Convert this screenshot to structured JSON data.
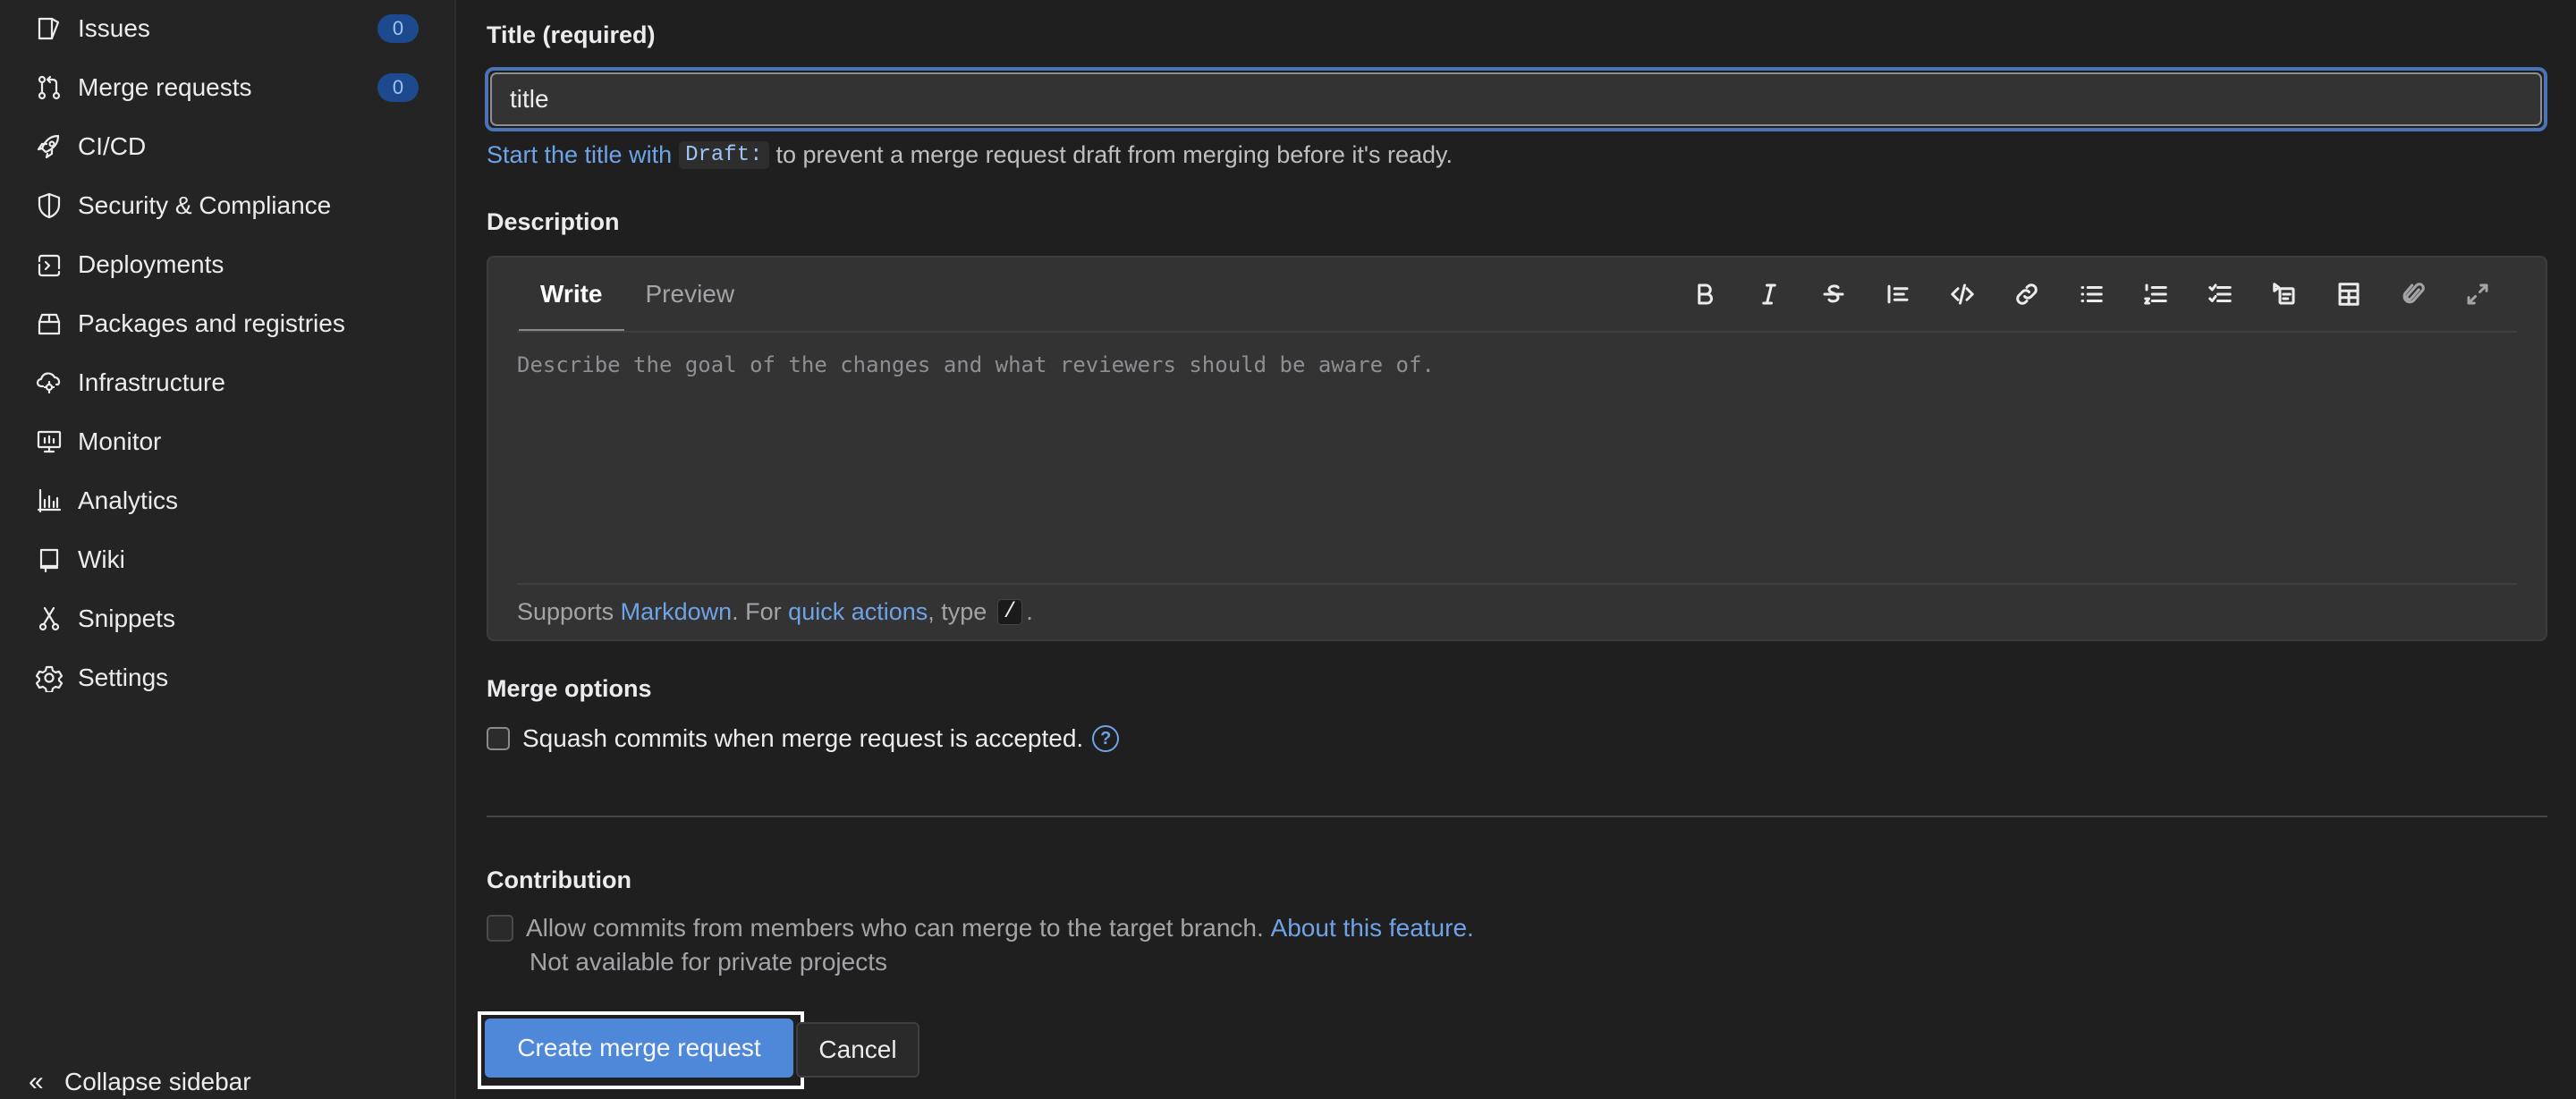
{
  "sidebar": {
    "items": [
      {
        "label": "Issues",
        "icon": "issues-icon",
        "badge": "0"
      },
      {
        "label": "Merge requests",
        "icon": "merge-request-icon",
        "badge": "0"
      },
      {
        "label": "CI/CD",
        "icon": "rocket-icon"
      },
      {
        "label": "Security & Compliance",
        "icon": "shield-icon"
      },
      {
        "label": "Deployments",
        "icon": "deployments-icon"
      },
      {
        "label": "Packages and registries",
        "icon": "package-icon"
      },
      {
        "label": "Infrastructure",
        "icon": "cloud-gear-icon"
      },
      {
        "label": "Monitor",
        "icon": "monitor-icon"
      },
      {
        "label": "Analytics",
        "icon": "chart-icon"
      },
      {
        "label": "Wiki",
        "icon": "book-icon"
      },
      {
        "label": "Snippets",
        "icon": "scissors-icon"
      },
      {
        "label": "Settings",
        "icon": "gear-icon"
      }
    ],
    "collapse_label": "Collapse sidebar"
  },
  "form": {
    "title_label": "Title (required)",
    "title_value": "title",
    "hint_prefix": "Start the title with",
    "hint_code": "Draft:",
    "hint_suffix": "to prevent a merge request draft from merging before it's ready.",
    "description_label": "Description",
    "tabs": [
      {
        "label": "Write",
        "active": true
      },
      {
        "label": "Preview",
        "active": false
      }
    ],
    "toolbar": [
      {
        "name": "bold-icon",
        "title": "Add bold text"
      },
      {
        "name": "italic-icon",
        "title": "Add italic text"
      },
      {
        "name": "strikethrough-icon",
        "title": "Add strikethrough text"
      },
      {
        "name": "quote-icon",
        "title": "Insert a quote"
      },
      {
        "name": "code-icon",
        "title": "Insert code"
      },
      {
        "name": "link-icon",
        "title": "Add a link"
      },
      {
        "name": "bullet-list-icon",
        "title": "Add a bullet list"
      },
      {
        "name": "numbered-list-icon",
        "title": "Add a numbered list"
      },
      {
        "name": "task-list-icon",
        "title": "Add a checklist"
      },
      {
        "name": "collapsible-icon",
        "title": "Add a collapsible section"
      },
      {
        "name": "table-icon",
        "title": "Add a table"
      },
      {
        "name": "attach-icon",
        "title": "Attach a file or image"
      },
      {
        "name": "fullscreen-icon",
        "title": "Go full screen"
      }
    ],
    "description_placeholder": "Describe the goal of the changes and what reviewers should be aware of.",
    "footer_prefix": "Supports",
    "footer_markdown": "Markdown",
    "footer_middle": ". For",
    "footer_quick_actions": "quick actions",
    "footer_type": ", type",
    "footer_code": "/",
    "footer_end": ".",
    "merge_options_label": "Merge options",
    "squash_label": "Squash commits when merge request is accepted.",
    "squash_checked": false,
    "help_glyph": "?",
    "contribution_label": "Contribution",
    "allow_commits_label": "Allow commits from members who can merge to the target branch.",
    "about_feature_link": "About this feature.",
    "allow_commits_checked": false,
    "not_available_text": "Not available for private projects",
    "create_button": "Create merge request",
    "cancel_button": "Cancel"
  },
  "colors": {
    "accent": "#5088d9",
    "link": "#6ea3e8",
    "badge_bg": "#1d4a8f",
    "focus_ring": "#4a73b8"
  }
}
